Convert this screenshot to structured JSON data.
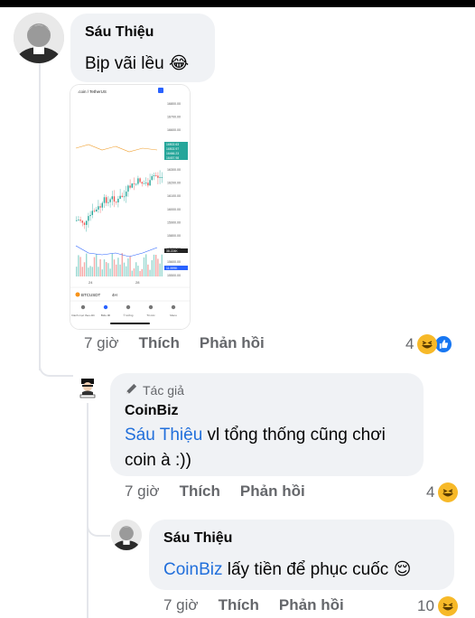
{
  "comment1": {
    "author": "Sáu Thiệu",
    "text": "Bịp vãi lều",
    "emoji": "😂",
    "time": "7 giờ",
    "like": "Thích",
    "reply": "Phản hồi",
    "reactions": "4"
  },
  "chart_shot": {
    "pair_title": ".coin / TetherUS",
    "symbol": "BTCUSDT",
    "interval": "4H",
    "price_labels": [
      "16800.00",
      "16700.00",
      "16600.00",
      "16500.00",
      "16400.00",
      "16300.00",
      "16200.00",
      "16100.00",
      "16000.00",
      "15900.00",
      "15800.00",
      "15700.00",
      "15600.00",
      "15500.00"
    ],
    "tags": [
      "16502.63",
      "16502.97",
      "16466.23",
      "16457.98",
      "38.224K",
      "11.599K"
    ],
    "x_labels": [
      "24",
      "28"
    ],
    "nav": [
      "Danh mục theo dõi",
      "Biểu đồ",
      "Ý tưởng",
      "Tin tức",
      "Menu"
    ]
  },
  "comment2": {
    "badge": "Tác giả",
    "author": "CoinBiz",
    "mention": "Sáu Thiệu",
    "text": " vl tổng thống cũng chơi coin à :))",
    "time": "7 giờ",
    "like": "Thích",
    "reply": "Phản hồi",
    "reactions": "4"
  },
  "comment3": {
    "author": "Sáu Thiệu",
    "mention": "CoinBiz",
    "text": " lấy tiền để phục cuốc",
    "emoji": "😌",
    "time": "7 giờ",
    "like": "Thích",
    "reply": "Phản hồi",
    "reactions": "10"
  }
}
